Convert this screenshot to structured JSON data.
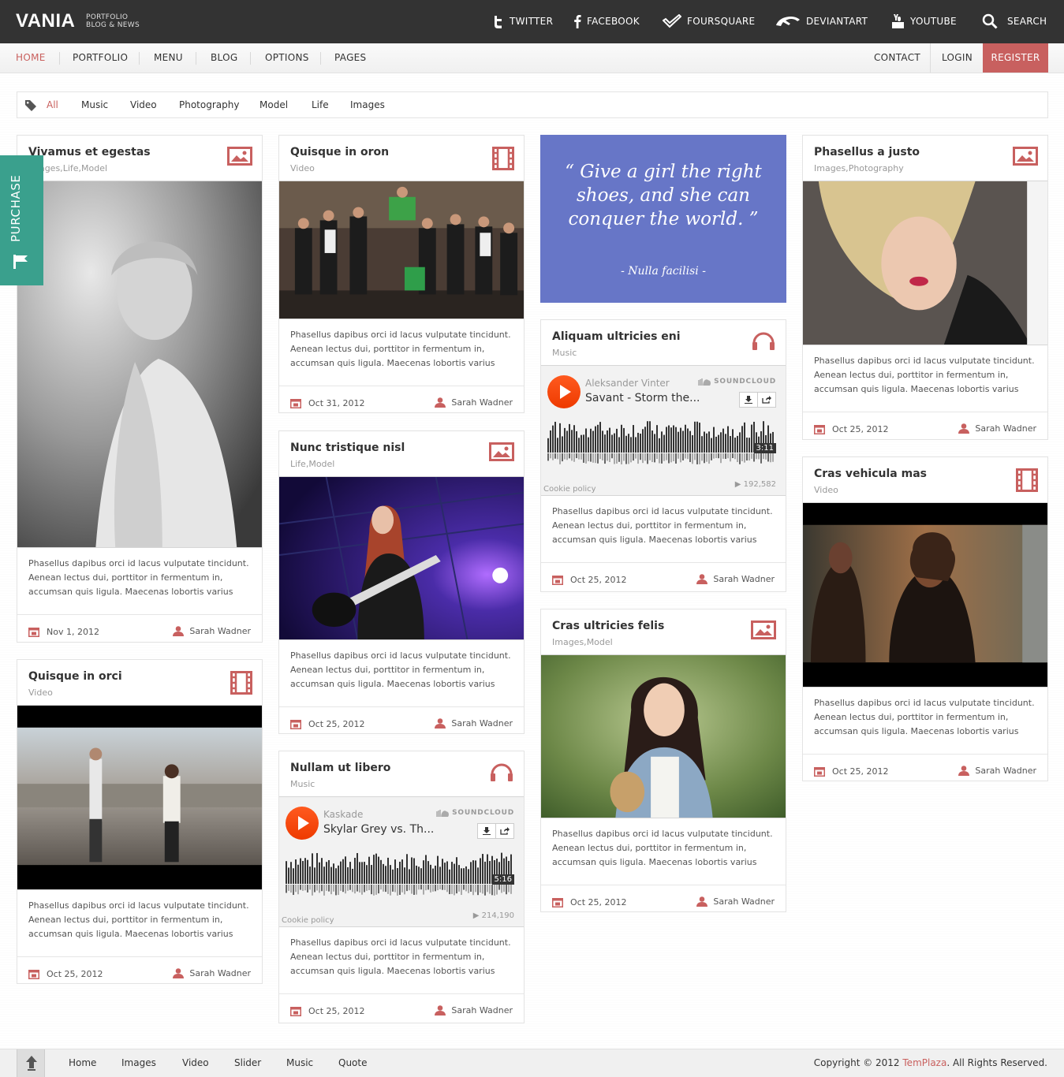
{
  "header": {
    "logo": "VANIA",
    "tagline_1": "PORTFOLIO",
    "tagline_2": "BLOG & NEWS",
    "social": [
      {
        "label": "TWITTER",
        "icon": "twitter-icon"
      },
      {
        "label": "FACEBOOK",
        "icon": "facebook-icon"
      },
      {
        "label": "FOURSQUARE",
        "icon": "foursquare-icon"
      },
      {
        "label": "DEVIANTART",
        "icon": "deviantart-icon"
      },
      {
        "label": "YOUTUBE",
        "icon": "youtube-icon"
      },
      {
        "label": "SEARCH",
        "icon": "search-icon"
      }
    ]
  },
  "nav": {
    "items": [
      "HOME",
      "PORTFOLIO",
      "MENU",
      "BLOG",
      "OPTIONS",
      "PAGES"
    ],
    "contact": "CONTACT",
    "login": "LOGIN",
    "register": "REGISTER"
  },
  "filters": [
    "All",
    "Music",
    "Video",
    "Photography",
    "Model",
    "Life",
    "Images"
  ],
  "purchase": "PURCHASE",
  "excerpt": "Phasellus dapibus orci id lacus vulputate tincidunt. Aenean lectus dui, porttitor in fermentum in, accumsan quis ligula. Maecenas lobortis varius",
  "cards": {
    "c1": {
      "title": "Vivamus et egestas",
      "cats": [
        "Images,",
        "Life,",
        "Model"
      ],
      "date": "Nov 1, 2012",
      "author": "Sarah Wadner"
    },
    "c2": {
      "title": "Quisque in orci",
      "cats": [
        "Video"
      ],
      "date": "Oct 25, 2012",
      "author": "Sarah Wadner"
    },
    "c3": {
      "title": "Quisque in oron",
      "cats": [
        "Video"
      ],
      "date": "Oct 31, 2012",
      "author": "Sarah Wadner"
    },
    "c4": {
      "title": "Nunc tristique nisl",
      "cats": [
        "Life,",
        "Model"
      ],
      "date": "Oct 25, 2012",
      "author": "Sarah Wadner"
    },
    "c5": {
      "title": "Nullam ut libero",
      "cats": [
        "Music"
      ],
      "date": "Oct 25, 2012",
      "author": "Sarah Wadner",
      "sc": {
        "artist": "Kaskade",
        "track": "Skylar Grey vs. Th...",
        "time": "5:16",
        "plays": "214,190",
        "brand": "SOUNDCLOUD",
        "cookie": "Cookie policy"
      }
    },
    "c6": {
      "title": "Aliquam ultricies eni",
      "cats": [
        "Music"
      ],
      "date": "Oct 25, 2012",
      "author": "Sarah Wadner",
      "sc": {
        "artist": "Aleksander Vinter",
        "track": "Savant - Storm the...",
        "time": "3:11",
        "plays": "192,582",
        "brand": "SOUNDCLOUD",
        "cookie": "Cookie policy"
      }
    },
    "c7": {
      "title": "Cras ultricies felis",
      "cats": [
        "Images,",
        "Model"
      ],
      "date": "Oct 25, 2012",
      "author": "Sarah Wadner"
    },
    "c8": {
      "title": "Phasellus a justo",
      "cats": [
        "Images,",
        "Photography"
      ],
      "date": "Oct 25, 2012",
      "author": "Sarah Wadner"
    },
    "c9": {
      "title": "Cras vehicula mas",
      "cats": [
        "Video"
      ],
      "date": "Oct 25, 2012",
      "author": "Sarah Wadner"
    }
  },
  "quote": {
    "text": "“ Give a girl the right shoes, and she can conquer the world. ”",
    "author": "- Nulla facilisi -"
  },
  "footer": {
    "links": [
      "Home",
      "Images",
      "Video",
      "Slider",
      "Music",
      "Quote"
    ],
    "copyright_pre": "Copyright © 2012 ",
    "copyright_brand": "TemPlaza",
    "copyright_post": ". All Rights Reserved."
  },
  "colors": {
    "accent": "#c8605f",
    "topbar": "#333333",
    "quote_bg": "#6776c7",
    "purchase_bg": "#3aa08d",
    "soundcloud": "#ff5500"
  }
}
